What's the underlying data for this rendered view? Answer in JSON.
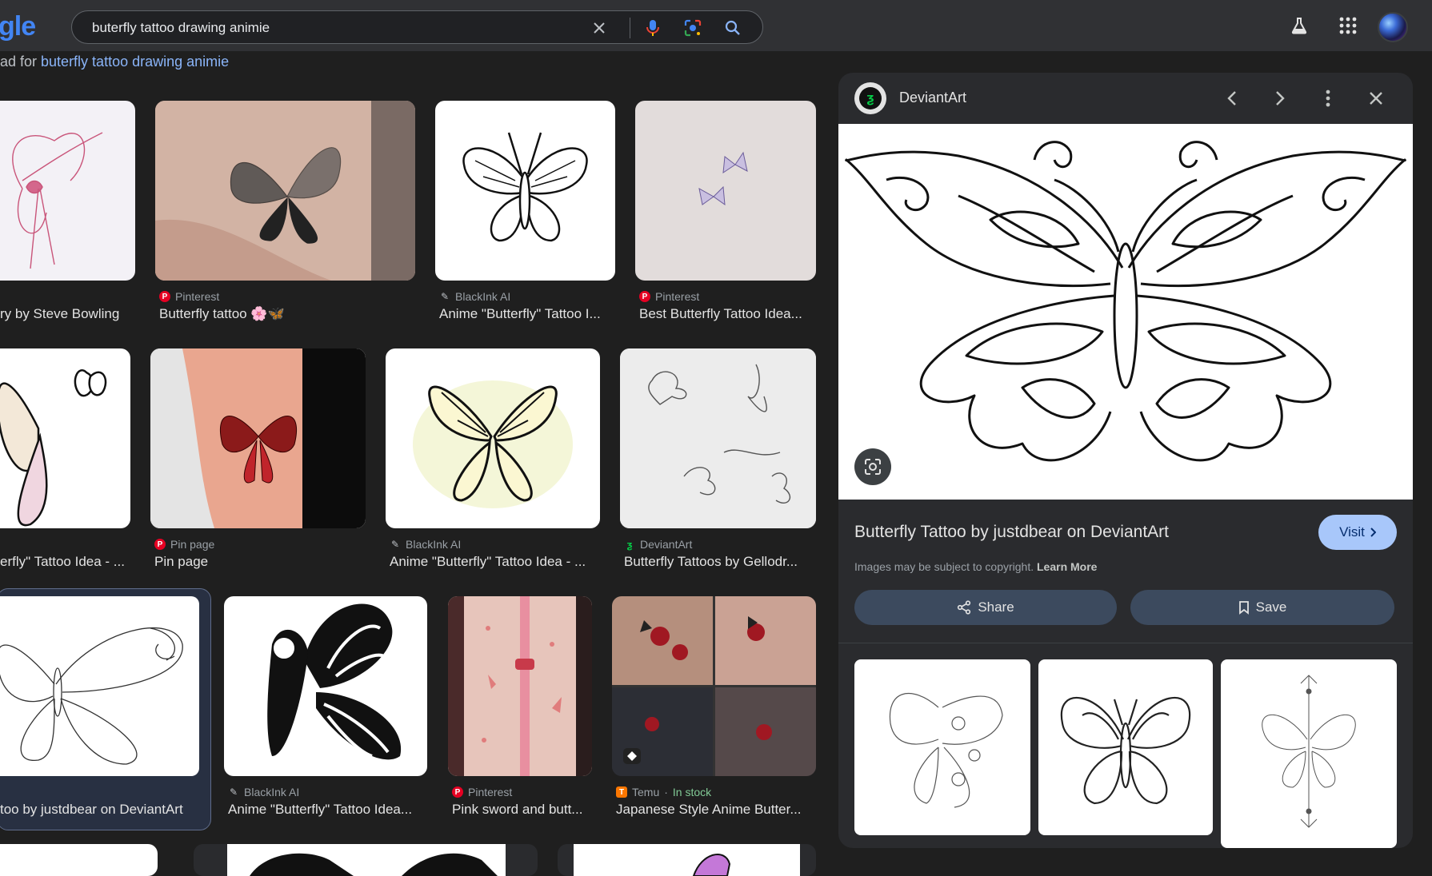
{
  "search": {
    "logo_fragment": "gle",
    "query": "buterfly tattoo drawing animie"
  },
  "subline": {
    "prefix": "ad for ",
    "link": "buterfly tattoo drawing animie"
  },
  "icons": {
    "clear": "close-icon",
    "voice": "mic-icon",
    "lens": "lens-icon",
    "search": "search-icon",
    "labs": "flask-icon",
    "apps": "apps-grid-icon",
    "account": "avatar"
  },
  "results": [
    {
      "source": "",
      "title": "ry by Steve Bowling"
    },
    {
      "source": "Pinterest",
      "title": "Butterfly tattoo 🌸🦋"
    },
    {
      "source": "BlackInk AI",
      "title": "Anime \"Butterfly\" Tattoo I..."
    },
    {
      "source": "Pinterest",
      "title": "Best Butterfly Tattoo Idea..."
    },
    {
      "source": "",
      "title": "erfly\" Tattoo Idea - ..."
    },
    {
      "source": "Pin page",
      "title": "Pin page"
    },
    {
      "source": "BlackInk AI",
      "title": "Anime \"Butterfly\" Tattoo Idea - ..."
    },
    {
      "source": "DeviantArt",
      "title": "Butterfly Tattoos by Gellodr..."
    },
    {
      "source": "",
      "title": "too by justdbear on DeviantArt"
    },
    {
      "source": "BlackInk AI",
      "title": "Anime \"Butterfly\" Tattoo Idea..."
    },
    {
      "source": "Pinterest",
      "title": "Pink sword and butt..."
    },
    {
      "source": "Temu",
      "source_extra": "In stock",
      "title": "Japanese Style Anime Butter..."
    }
  ],
  "panel": {
    "source": "DeviantArt",
    "title": "Butterfly Tattoo by justdbear on DeviantArt",
    "visit": "Visit",
    "copyright": "Images may be subject to copyright.",
    "learn_more": "Learn More",
    "share": "Share",
    "save": "Save"
  },
  "colors": {
    "background": "#1f1f1f",
    "topbar": "#303134",
    "link": "#8ab4f8",
    "visit_button": "#a8c7fa",
    "in_stock": "#81c995"
  }
}
